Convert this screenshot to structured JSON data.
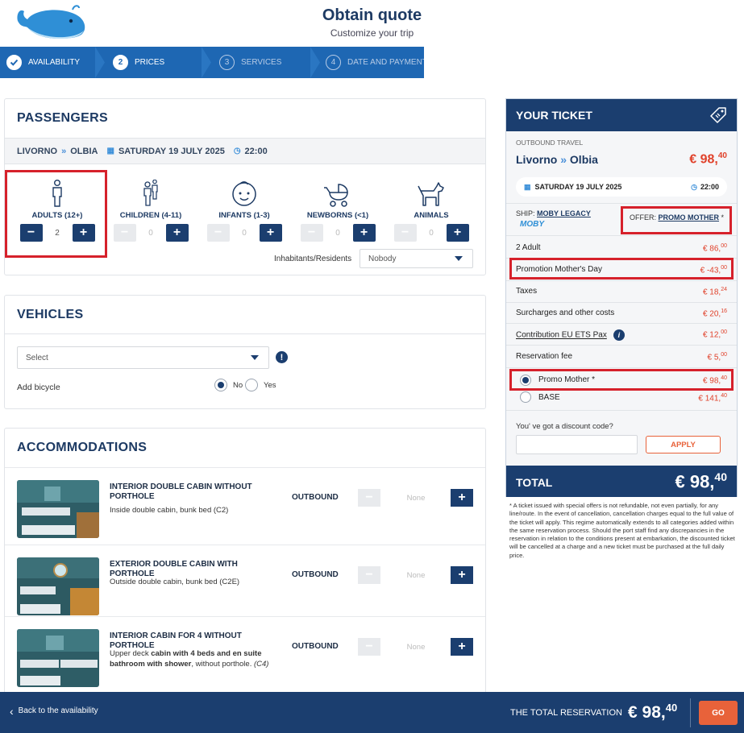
{
  "header": {
    "title": "Obtain quote",
    "subtitle": "Customize your trip"
  },
  "steps": [
    {
      "num": "",
      "label": "AVAILABILITY",
      "state": "done"
    },
    {
      "num": "2",
      "label": "PRICES",
      "state": "active"
    },
    {
      "num": "3",
      "label": "SERVICES",
      "state": "todo"
    },
    {
      "num": "4",
      "label": "DATE AND PAYMENT",
      "state": "todo"
    }
  ],
  "passengers": {
    "title": "PASSENGERS",
    "route": {
      "from": "LIVORNO",
      "to": "OLBIA",
      "date": "SATURDAY 19 JULY 2025",
      "time": "22:00"
    },
    "types": [
      {
        "label": "ADULTS (12+)",
        "value": "2",
        "icon": "adult-icon"
      },
      {
        "label": "CHILDREN (4-11)",
        "value": "0",
        "icon": "child-icon"
      },
      {
        "label": "INFANTS (1-3)",
        "value": "0",
        "icon": "infant-icon"
      },
      {
        "label": "NEWBORNS (<1)",
        "value": "0",
        "icon": "stroller-icon"
      },
      {
        "label": "ANIMALS",
        "value": "0",
        "icon": "dog-icon"
      }
    ],
    "residents_label": "Inhabitants/Residents",
    "residents_value": "Nobody"
  },
  "vehicles": {
    "title": "VEHICLES",
    "select_value": "Select",
    "bicycle_label": "Add bicycle",
    "bicycle_no": "No",
    "bicycle_yes": "Yes",
    "bicycle_selected": "No"
  },
  "accommodations": {
    "title": "ACCOMMODATIONS",
    "items": [
      {
        "name": "INTERIOR DOUBLE CABIN WITHOUT PORTHOLE",
        "desc": "Inside double cabin, bunk bed (C2)",
        "direction": "OUTBOUND",
        "value": "None"
      },
      {
        "name": "EXTERIOR DOUBLE CABIN WITH PORTHOLE",
        "desc": "Outside double cabin, bunk bed (C2E)",
        "direction": "OUTBOUND",
        "value": "None"
      },
      {
        "name": "INTERIOR CABIN FOR 4 WITHOUT PORTHOLE",
        "desc_a": "Upper deck ",
        "desc_b": "cabin with 4 beds and en suite bathroom with shower",
        "desc_c": ", without porthole. ",
        "desc_d": "(C4)",
        "direction": "OUTBOUND",
        "value": "None"
      }
    ]
  },
  "ticket": {
    "title": "YOUR TICKET",
    "travel_label": "OUTBOUND TRAVEL",
    "from": "Livorno",
    "to": "Olbia",
    "price_main": "€ 98,",
    "price_cents": "40",
    "date": "SATURDAY 19 JULY 2025",
    "time": "22:00",
    "ship_label": "SHIP:",
    "ship_name": "MOBY LEGACY",
    "brand": "MOBY",
    "offer_label": "OFFER:",
    "offer_name": "PROMO MOTHER",
    "offer_mark": "*",
    "lines": [
      {
        "label": "2 Adult",
        "amount": "€ 86,",
        "cents": "00"
      },
      {
        "label": "Promotion Mother's Day",
        "amount": "€ -43,",
        "cents": "00"
      },
      {
        "label": "Taxes",
        "amount": "€ 18,",
        "cents": "24"
      },
      {
        "label": "Surcharges and other costs",
        "amount": "€ 20,",
        "cents": "16"
      },
      {
        "label": "Contribution EU ETS Pax",
        "amount": "€ 12,",
        "cents": "00"
      },
      {
        "label": "Reservation fee",
        "amount": "€ 5,",
        "cents": "00"
      }
    ],
    "fares": [
      {
        "label": "Promo Mother *",
        "amount": "€ 98,",
        "cents": "40",
        "selected": true
      },
      {
        "label": "BASE",
        "amount": "€ 141,",
        "cents": "40",
        "selected": false
      }
    ],
    "discount_label": "You' ve got a discount code?",
    "discount_placeholder": "",
    "apply_label": "APPLY",
    "total_label": "TOTAL",
    "total_main": "€ 98,",
    "total_cents": "40"
  },
  "footnote": "* A ticket issued with special offers is not refundable, not even partially, for any line/route. In the event of cancellation, cancellation charges equal to the full value of the ticket will apply. This regime automatically extends to all categories added within the same reservation process. Should the port staff find any discrepancies in the reservation in relation to the conditions present at embarkation, the discounted ticket will be cancelled at a charge and a new ticket must be purchased at the full daily price.",
  "bottom": {
    "back_label": "Back to the availability",
    "total_label": "THE TOTAL RESERVATION",
    "total_main": "€ 98,",
    "total_cents": "40",
    "go_label": "GO"
  },
  "colors": {
    "navy": "#1b3e6f",
    "step_blue": "#1e67b3",
    "price_red": "#e0412a",
    "highlight_red": "#d6212b",
    "apply_orange": "#e8623a"
  }
}
